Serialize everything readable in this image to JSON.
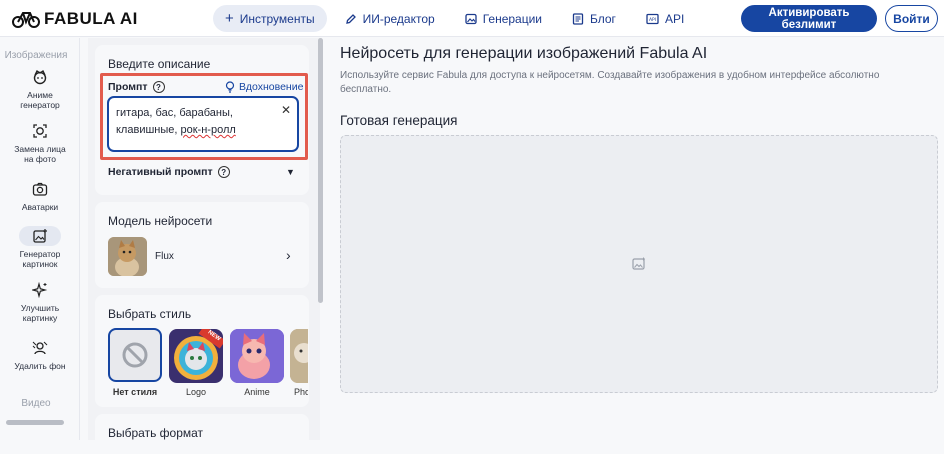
{
  "brand": {
    "name": "FABULA AI"
  },
  "nav": [
    {
      "label": "Инструменты",
      "icon": "plus-icon",
      "active": true
    },
    {
      "label": "ИИ-редактор",
      "icon": "pen-icon",
      "active": false
    },
    {
      "label": "Генерации",
      "icon": "image-icon",
      "active": false
    },
    {
      "label": "Блог",
      "icon": "document-icon",
      "active": false
    },
    {
      "label": "API",
      "icon": "api-icon",
      "active": false
    }
  ],
  "actions": {
    "activate": "Активировать безлимит",
    "login": "Войти"
  },
  "rail": {
    "section_images": "Изображения",
    "items": [
      {
        "label_1": "Аниме",
        "label_2": "генератор",
        "icon": "anime-face-icon"
      },
      {
        "label_1": "Замена лица",
        "label_2": "на фото",
        "icon": "face-swap-icon"
      },
      {
        "label_1": "Аватарки",
        "label_2": "",
        "icon": "camera-icon"
      },
      {
        "label_1": "Генератор",
        "label_2": "картинок",
        "icon": "image-generator-icon",
        "active": true
      },
      {
        "label_1": "Улучшить",
        "label_2": "картинку",
        "icon": "sparkle-icon"
      },
      {
        "label_1": "Удалить фон",
        "label_2": "",
        "icon": "remove-bg-icon"
      }
    ],
    "section_video": "Видео"
  },
  "form": {
    "description_title": "Введите описание",
    "prompt_label": "Промпт",
    "inspiration_label": "Вдохновение",
    "prompt_value_line1": "гитара, бас, барабаны,",
    "prompt_value_line2_a": "клавишные, ",
    "prompt_value_line2_b": "рок-н-ролл",
    "negative_label": "Негативный промпт",
    "model_title": "Модель нейросети",
    "model_name": "Flux",
    "style_title": "Выбрать стиль",
    "styles": [
      {
        "label": "Нет стиля",
        "selected": true
      },
      {
        "label": "Logo",
        "badge": "NEW"
      },
      {
        "label": "Anime"
      },
      {
        "label": "Pho"
      }
    ],
    "format_title": "Выбрать формат"
  },
  "main": {
    "title": "Нейросеть для генерации изображений Fabula AI",
    "description": "Используйте сервис Fabula для доступа к нейросетям. Создавайте изображения в удобном интерфейсе абсолютно бесплатно.",
    "result_title": "Готовая генерация"
  },
  "colors": {
    "accent": "#1746a2",
    "highlight": "#e25b4d"
  }
}
